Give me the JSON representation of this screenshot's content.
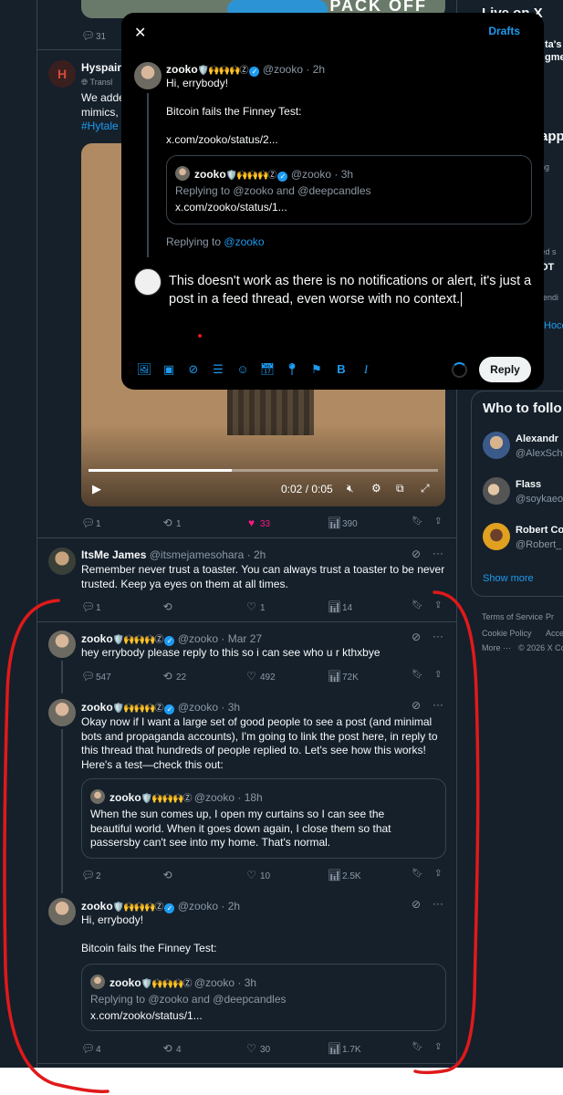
{
  "top_post": {
    "reply_count": "31"
  },
  "hyspain": {
    "name": "Hyspain",
    "translate": "Transl",
    "body_line1": "We adde",
    "body_line2": "mimics, ",
    "hashtag": "#Hytale"
  },
  "video": {
    "time": "0:02 / 0:05",
    "progress": 0.41
  },
  "hyspain_actions": {
    "replies": "1",
    "reposts": "1",
    "likes": "33",
    "views": "390"
  },
  "james_post": {
    "name": "ItsMe James",
    "handle": "@itsmejamesohara",
    "time": "· 2h",
    "body": "Remember never trust a toaster. You can always trust a toaster to be never trusted. Keep ya eyes on them at all times.",
    "replies": "1",
    "reposts": "",
    "likes": "1",
    "views": "14"
  },
  "zooko_post_1": {
    "name": "zooko",
    "handle": "@zooko",
    "time": "· Mar 27",
    "body": "hey errybody please reply to this so i can see who u r kthxbye",
    "replies": "547",
    "reposts": "22",
    "likes": "492",
    "views": "72K"
  },
  "zooko_post_2": {
    "name": "zooko",
    "handle": "@zooko",
    "time": "· 3h",
    "body": "Okay now if I want a large set of good people to see a post (and minimal bots and propaganda accounts), I'm going to link the post here, in reply to this thread that hundreds of people replied to. Let's see how this works! Here's a test—check this out:",
    "quote": {
      "name": "zooko",
      "handle": "@zooko",
      "time": "· 18h",
      "body": "When the sun comes up, I open my curtains so I can see the beautiful world. When it goes down again, I close them so that passersby can't see into my home. That's normal."
    },
    "replies": "2",
    "reposts": "",
    "likes": "10",
    "views": "2.5K"
  },
  "zooko_post_3": {
    "name": "zooko",
    "handle": "@zooko",
    "time": "· 2h",
    "line1": "Hi, errybody!",
    "line2": "Bitcoin fails the Finney Test:",
    "quote": {
      "name": "zooko",
      "handle": "@zooko",
      "time": "· 3h",
      "replying": "Replying to @zooko and @deepcandles",
      "link": "x.com/zooko/status/1..."
    },
    "replies": "4",
    "reposts": "4",
    "likes": "30",
    "views": "1.7K"
  },
  "emoji_string": "🛡️🙌🙌🙌Ⓩ",
  "right_col": {
    "live": "Live on X",
    "what": "What's happening",
    "live_sub1": "ta's",
    "live_sub2": "gme",
    "happ": "app",
    "ng": "ng",
    "ted": "ted s",
    "ot": "OT",
    "trending": "rendi",
    "hoce": "Hoce",
    "who_to_follow": "Who to follo",
    "follow": [
      {
        "name": "Alexandr",
        "handle": "@AlexSch"
      },
      {
        "name": "Flass",
        "handle": "@soykaeo"
      },
      {
        "name": "Robert Co",
        "handle": "@Robert_"
      }
    ],
    "show_more": "Show more",
    "footer1": "Terms of Service",
    "footer1b": "Pr",
    "footer2": "Cookie Policy",
    "footer2b": "Acce",
    "footer3": "More ···",
    "footer3b": "© 2026 X Co"
  },
  "modal": {
    "drafts": "Drafts",
    "orig": {
      "name": "zooko",
      "handle": "@zooko",
      "time": "· 2h",
      "line1": "Hi, errybody!",
      "line2": "Bitcoin fails the Finney Test:",
      "link": "x.com/zooko/status/2...",
      "quote": {
        "name": "zooko",
        "handle": "@zooko",
        "time": "· 3h",
        "replying": "Replying to @zooko and @deepcandles",
        "link": "x.com/zooko/status/1..."
      }
    },
    "replying_to_prefix": "Replying to",
    "replying_to_handle": "@zooko",
    "compose_text": "This doesn't work as there is no notifications or alert, it's just a post in a feed thread, even worse with no context.",
    "reply_button": "Reply"
  },
  "colors": {
    "accent": "#1d9bf0",
    "background": "#15202b",
    "annotation": "#e0191a",
    "like": "#f91880"
  }
}
